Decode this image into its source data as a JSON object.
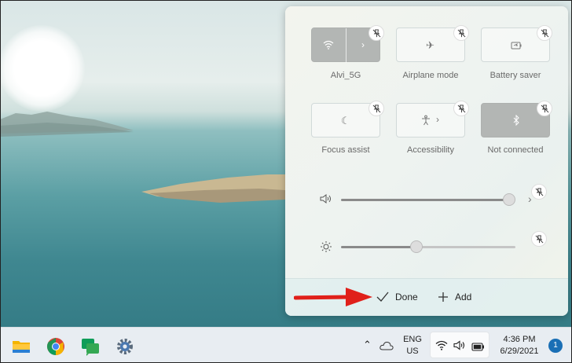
{
  "quick_settings": {
    "tiles": [
      {
        "label": "Alvi_5G",
        "icon": "wifi-icon",
        "state": "on",
        "has_chevron": true
      },
      {
        "label": "Airplane mode",
        "icon": "airplane-icon",
        "state": "off",
        "has_chevron": false
      },
      {
        "label": "Battery saver",
        "icon": "battery-saver-icon",
        "state": "off",
        "has_chevron": false
      },
      {
        "label": "Focus assist",
        "icon": "moon-icon",
        "state": "off",
        "has_chevron": false
      },
      {
        "label": "Accessibility",
        "icon": "accessibility-icon",
        "state": "off",
        "has_chevron": true
      },
      {
        "label": "Not connected",
        "icon": "bluetooth-icon",
        "state": "on",
        "has_chevron": false
      }
    ],
    "volume": {
      "icon": "speaker-icon",
      "level": 1.0
    },
    "brightness": {
      "icon": "brightness-icon",
      "level": 0.45
    },
    "footer": {
      "done_label": "Done",
      "add_label": "Add"
    }
  },
  "taskbar": {
    "apps": [
      "file-explorer-icon",
      "chrome-icon",
      "google-chat-icon",
      "settings-icon"
    ],
    "language_line1": "ENG",
    "language_line2": "US",
    "time": "4:36 PM",
    "date": "6/29/2021",
    "notification_count": "1"
  },
  "colors": {
    "tile_on": "#b3b6b4",
    "arrow": "#e0201a",
    "badge": "#1a6fb5"
  }
}
